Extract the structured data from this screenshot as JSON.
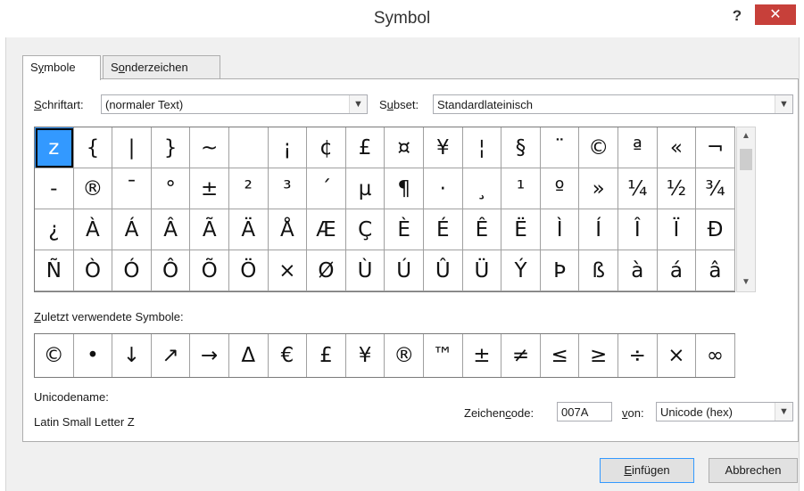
{
  "window": {
    "title": "Symbol",
    "help_label": "?",
    "close_label": "✕"
  },
  "tabs": [
    {
      "label_pre": "S",
      "label_u": "y",
      "label_post": "mbole",
      "active": true
    },
    {
      "label_pre": "S",
      "label_u": "o",
      "label_post": "nderzeichen",
      "active": false
    }
  ],
  "font": {
    "label_u": "S",
    "label_post": "chriftart:",
    "value": "(normaler Text)"
  },
  "subset": {
    "label_pre": "S",
    "label_u": "u",
    "label_post": "bset:",
    "value": "Standardlateinisch"
  },
  "symbol_grid": {
    "rows": [
      [
        "z",
        "{",
        "|",
        "}",
        "~",
        " ",
        "¡",
        "¢",
        "£",
        "¤",
        "¥",
        "¦",
        "§",
        "¨",
        "©",
        "ª",
        "«",
        "¬"
      ],
      [
        "-",
        "®",
        "¯",
        "°",
        "±",
        "²",
        "³",
        "´",
        "µ",
        "¶",
        "·",
        "¸",
        "¹",
        "º",
        "»",
        "¼",
        "½",
        "¾"
      ],
      [
        "¿",
        "À",
        "Á",
        "Â",
        "Ã",
        "Ä",
        "Å",
        "Æ",
        "Ç",
        "È",
        "É",
        "Ê",
        "Ë",
        "Ì",
        "Í",
        "Î",
        "Ï",
        "Ð"
      ],
      [
        "Ñ",
        "Ò",
        "Ó",
        "Ô",
        "Õ",
        "Ö",
        "×",
        "Ø",
        "Ù",
        "Ú",
        "Û",
        "Ü",
        "Ý",
        "Þ",
        "ß",
        "à",
        "á",
        "â"
      ]
    ],
    "selected": "z"
  },
  "recent": {
    "label_u": "Z",
    "label_post": "uletzt verwendete Symbole:",
    "symbols": [
      "©",
      "•",
      "↓",
      "↗",
      "→",
      "Δ",
      "€",
      "£",
      "¥",
      "®",
      "™",
      "±",
      "≠",
      "≤",
      "≥",
      "÷",
      "×",
      "∞"
    ]
  },
  "unicode": {
    "name_label": "Unicodename:",
    "name_value": "Latin Small Letter Z",
    "code_label_pre": "Zeichen",
    "code_label_u": "c",
    "code_label_post": "ode:",
    "code_value": "007A",
    "from_label_u": "v",
    "from_label_post": "on:",
    "from_value": "Unicode (hex)"
  },
  "buttons": {
    "insert_u": "E",
    "insert_post": "infügen",
    "cancel": "Abbrechen"
  },
  "icons": {
    "dropdown": "chevron-down-icon",
    "scroll_up": "chevron-up-icon",
    "scroll_down": "chevron-down-icon"
  }
}
